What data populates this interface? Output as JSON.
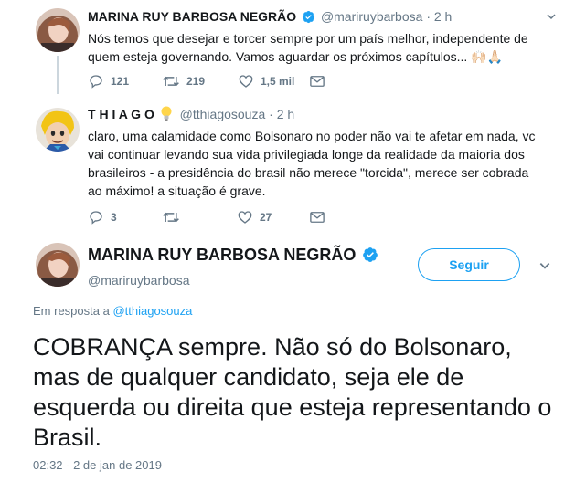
{
  "tweet1": {
    "name": "MARINA RUY BARBOSA NEGRÃO",
    "handle": "@mariruybarbosa",
    "separator": "·",
    "time": "2 h",
    "text": "Nós temos que desejar e torcer sempre por um país melhor, independente de quem esteja governando. Vamos aguardar os próximos capítulos... 🙌🏻🙏🏻",
    "replies": "121",
    "retweets": "219",
    "likes": "1,5 mil"
  },
  "tweet2": {
    "name": "T H I A G O",
    "handle": "@tthiagosouza",
    "separator": "·",
    "time": "2 h",
    "text": "claro, uma calamidade como Bolsonaro no poder não vai te afetar em nada, vc vai continuar levando sua vida privilegiada longe da realidade da maioria dos brasileiros - a presidência do brasil não merece \"torcida\", merece ser cobrada ao máximo! a situação é grave.",
    "replies": "3",
    "retweets": "",
    "likes": "27"
  },
  "main": {
    "name": "MARINA RUY BARBOSA NEGRÃO",
    "handle": "@mariruybarbosa",
    "follow_label": "Seguir",
    "reply_prefix": "Em resposta a",
    "reply_handle": "@tthiagosouza",
    "text": "COBRANÇA sempre. Não só do Bolsonaro, mas de qualquer candidato, seja ele de esquerda ou direita que esteja representando o Brasil.",
    "timestamp": "02:32 - 2 de jan de 2019"
  },
  "colors": {
    "accent": "#1da1f2",
    "muted": "#657786",
    "line": "#ccd6dd"
  },
  "icons": [
    "verified-icon",
    "lightbulb-icon",
    "reply-icon",
    "retweet-icon",
    "like-icon",
    "dm-icon",
    "chevron-down-icon"
  ]
}
